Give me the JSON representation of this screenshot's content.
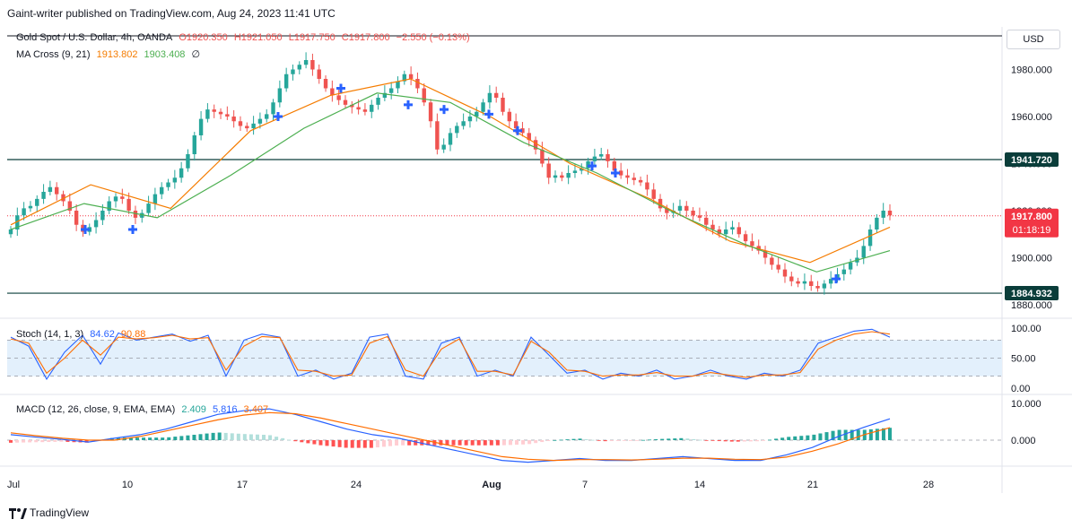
{
  "header": {
    "publisher_line": "Gaint-writer published on TradingView.com, Aug 24, 2023 11:41 UTC"
  },
  "legend": {
    "symbol": "Gold Spot / U.S. Dollar, 4h, OANDA",
    "open": "O1920.350",
    "high": "H1921.050",
    "low": "L1917.750",
    "close": "C1917.800",
    "change": "−2.550 (−0.13%)",
    "ma_label": "MA Cross (9, 21)",
    "ma_fast": "1913.802",
    "ma_slow": "1903.408",
    "ma_extra": "∅",
    "stoch_label": "Stoch (14, 1, 3)",
    "stoch_k": "84.62",
    "stoch_d": "90.88",
    "macd_label": "MACD (12, 26, close, 9, EMA, EMA)",
    "macd_hist": "2.409",
    "macd_line": "5.816",
    "macd_signal": "3.407"
  },
  "currency_button": "USD",
  "price_tags": {
    "resistance": "1941.720",
    "current": "1917.800",
    "countdown": "01:18:19",
    "support": "1884.932"
  },
  "footer": {
    "brand": "TradingView"
  },
  "colors": {
    "up": "#26a69a",
    "down": "#ef5350",
    "ma_fast": "#f57c00",
    "ma_slow": "#4caf50",
    "stoch_k": "#2962ff",
    "stoch_d": "#ff6d00",
    "stoch_band": "#e3f0fc",
    "level_line": "#0a3d3a",
    "current_tag": "#f23645",
    "cross_marker": "#2962ff"
  },
  "chart_data": [
    {
      "type": "candlestick",
      "title": "Gold Spot / U.S. Dollar, 4h, OANDA",
      "x_ticks": [
        "Jul",
        "10",
        "17",
        "24",
        "Aug",
        "7",
        "14",
        "21",
        "28"
      ],
      "y_ticks": [
        "1880.000",
        "1900.000",
        "1920.000",
        "1940.000",
        "1960.000",
        "1980.000"
      ],
      "ylim": [
        1875,
        1995
      ],
      "series": [
        {
          "name": "Price (approx. closes)",
          "values": [
            1912,
            1918,
            1921,
            1922,
            1925,
            1928,
            1930,
            1927,
            1924,
            1920,
            1914,
            1911,
            1913,
            1916,
            1920,
            1924,
            1926,
            1925,
            1920,
            1917,
            1919,
            1923,
            1927,
            1930,
            1932,
            1934,
            1938,
            1944,
            1952,
            1959,
            1963,
            1962,
            1961,
            1960,
            1958,
            1956,
            1955,
            1957,
            1959,
            1961,
            1966,
            1972,
            1978,
            1980,
            1982,
            1984,
            1980,
            1976,
            1972,
            1969,
            1967,
            1965,
            1964,
            1963,
            1962,
            1965,
            1968,
            1970,
            1972,
            1975,
            1978,
            1976,
            1972,
            1966,
            1958,
            1946,
            1948,
            1953,
            1956,
            1958,
            1960,
            1962,
            1966,
            1970,
            1968,
            1962,
            1958,
            1955,
            1953,
            1950,
            1946,
            1940,
            1934,
            1935,
            1934,
            1936,
            1937,
            1938,
            1941,
            1943,
            1944,
            1941,
            1937,
            1935,
            1934,
            1933,
            1932,
            1929,
            1925,
            1921,
            1919,
            1920,
            1922,
            1920,
            1918,
            1917,
            1914,
            1912,
            1910,
            1912,
            1913,
            1910,
            1907,
            1905,
            1903,
            1900,
            1897,
            1895,
            1892,
            1890,
            1889,
            1890,
            1888,
            1887,
            1889,
            1891,
            1893,
            1895,
            1898,
            1900,
            1905,
            1912,
            1917,
            1920,
            1918
          ]
        },
        {
          "name": "MA fast (9)",
          "values": [
            1914,
            1931,
            1921,
            1954,
            1969,
            1976,
            1960,
            1940,
            1925,
            1907,
            1898,
            1913
          ]
        },
        {
          "name": "MA slow (21)",
          "values": [
            1912,
            1923,
            1917,
            1935,
            1955,
            1970,
            1966,
            1949,
            1936,
            1920,
            1906,
            1894,
            1903
          ]
        }
      ],
      "horizontal_levels": [
        1941.72,
        1884.932
      ],
      "current_price": 1917.8
    },
    {
      "type": "line",
      "title": "Stoch (14, 1, 3)",
      "y_ticks": [
        "0.00",
        "50.00",
        "100.00"
      ],
      "ylim": [
        0,
        110
      ],
      "band": [
        20,
        80
      ],
      "series": [
        {
          "name": "%K (approx.)",
          "values": [
            85,
            70,
            15,
            60,
            88,
            40,
            92,
            80,
            85,
            90,
            78,
            88,
            20,
            80,
            90,
            85,
            20,
            30,
            15,
            25,
            85,
            90,
            20,
            15,
            75,
            85,
            20,
            30,
            20,
            85,
            55,
            25,
            30,
            15,
            25,
            20,
            30,
            15,
            20,
            30,
            20,
            15,
            25,
            20,
            30,
            75,
            85,
            95,
            98,
            85
          ]
        },
        {
          "name": "%D (approx.)",
          "values": [
            82,
            75,
            25,
            50,
            80,
            55,
            85,
            82,
            84,
            88,
            82,
            84,
            30,
            70,
            86,
            84,
            30,
            28,
            20,
            22,
            75,
            86,
            30,
            20,
            65,
            82,
            28,
            28,
            22,
            78,
            60,
            30,
            28,
            20,
            22,
            22,
            26,
            20,
            20,
            26,
            22,
            18,
            22,
            22,
            26,
            65,
            80,
            90,
            94,
            90
          ]
        }
      ]
    },
    {
      "type": "line",
      "title": "MACD (12, 26, close, 9, EMA, EMA)",
      "y_ticks": [
        "0.000",
        "10.000"
      ],
      "ylim": [
        -8,
        11
      ],
      "series": [
        {
          "name": "MACD (approx.)",
          "values": [
            1.5,
            0.8,
            0.2,
            -0.5,
            0.5,
            1.5,
            3,
            5,
            7,
            8,
            8.5,
            7,
            5,
            3,
            1.5,
            0.5,
            -1,
            -2.5,
            -4,
            -5.5,
            -6,
            -5.5,
            -5,
            -5.5,
            -5.5,
            -5,
            -4.5,
            -5,
            -5.5,
            -5.5,
            -4,
            -2,
            1,
            3.5,
            5.8
          ]
        },
        {
          "name": "Signal (approx.)",
          "values": [
            2,
            1.2,
            0.5,
            0,
            0,
            1,
            2.5,
            4,
            5.5,
            6.8,
            7.5,
            7.2,
            6,
            4.5,
            3,
            1.5,
            0,
            -1.5,
            -3,
            -4.5,
            -5.2,
            -5.5,
            -5.3,
            -5.3,
            -5.4,
            -5.2,
            -4.9,
            -4.9,
            -5.2,
            -5.3,
            -4.6,
            -3,
            -1,
            1.5,
            3.4
          ]
        }
      ]
    }
  ]
}
